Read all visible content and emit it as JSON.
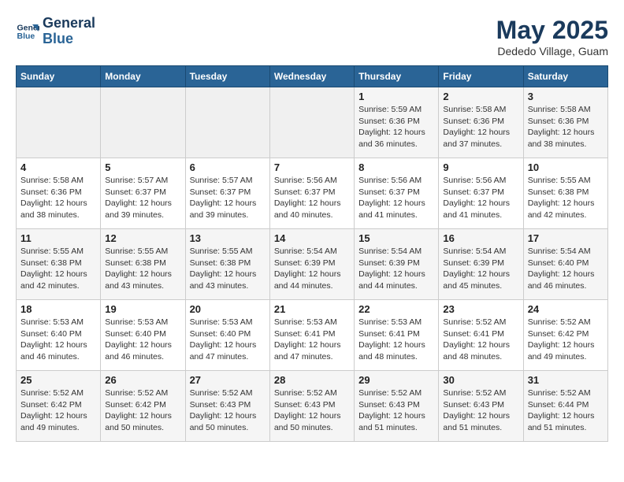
{
  "header": {
    "logo_line1": "General",
    "logo_line2": "Blue",
    "month": "May 2025",
    "location": "Dededo Village, Guam"
  },
  "weekdays": [
    "Sunday",
    "Monday",
    "Tuesday",
    "Wednesday",
    "Thursday",
    "Friday",
    "Saturday"
  ],
  "weeks": [
    [
      {
        "day": "",
        "text": ""
      },
      {
        "day": "",
        "text": ""
      },
      {
        "day": "",
        "text": ""
      },
      {
        "day": "",
        "text": ""
      },
      {
        "day": "1",
        "text": "Sunrise: 5:59 AM\nSunset: 6:36 PM\nDaylight: 12 hours\nand 36 minutes."
      },
      {
        "day": "2",
        "text": "Sunrise: 5:58 AM\nSunset: 6:36 PM\nDaylight: 12 hours\nand 37 minutes."
      },
      {
        "day": "3",
        "text": "Sunrise: 5:58 AM\nSunset: 6:36 PM\nDaylight: 12 hours\nand 38 minutes."
      }
    ],
    [
      {
        "day": "4",
        "text": "Sunrise: 5:58 AM\nSunset: 6:36 PM\nDaylight: 12 hours\nand 38 minutes."
      },
      {
        "day": "5",
        "text": "Sunrise: 5:57 AM\nSunset: 6:37 PM\nDaylight: 12 hours\nand 39 minutes."
      },
      {
        "day": "6",
        "text": "Sunrise: 5:57 AM\nSunset: 6:37 PM\nDaylight: 12 hours\nand 39 minutes."
      },
      {
        "day": "7",
        "text": "Sunrise: 5:56 AM\nSunset: 6:37 PM\nDaylight: 12 hours\nand 40 minutes."
      },
      {
        "day": "8",
        "text": "Sunrise: 5:56 AM\nSunset: 6:37 PM\nDaylight: 12 hours\nand 41 minutes."
      },
      {
        "day": "9",
        "text": "Sunrise: 5:56 AM\nSunset: 6:37 PM\nDaylight: 12 hours\nand 41 minutes."
      },
      {
        "day": "10",
        "text": "Sunrise: 5:55 AM\nSunset: 6:38 PM\nDaylight: 12 hours\nand 42 minutes."
      }
    ],
    [
      {
        "day": "11",
        "text": "Sunrise: 5:55 AM\nSunset: 6:38 PM\nDaylight: 12 hours\nand 42 minutes."
      },
      {
        "day": "12",
        "text": "Sunrise: 5:55 AM\nSunset: 6:38 PM\nDaylight: 12 hours\nand 43 minutes."
      },
      {
        "day": "13",
        "text": "Sunrise: 5:55 AM\nSunset: 6:38 PM\nDaylight: 12 hours\nand 43 minutes."
      },
      {
        "day": "14",
        "text": "Sunrise: 5:54 AM\nSunset: 6:39 PM\nDaylight: 12 hours\nand 44 minutes."
      },
      {
        "day": "15",
        "text": "Sunrise: 5:54 AM\nSunset: 6:39 PM\nDaylight: 12 hours\nand 44 minutes."
      },
      {
        "day": "16",
        "text": "Sunrise: 5:54 AM\nSunset: 6:39 PM\nDaylight: 12 hours\nand 45 minutes."
      },
      {
        "day": "17",
        "text": "Sunrise: 5:54 AM\nSunset: 6:40 PM\nDaylight: 12 hours\nand 46 minutes."
      }
    ],
    [
      {
        "day": "18",
        "text": "Sunrise: 5:53 AM\nSunset: 6:40 PM\nDaylight: 12 hours\nand 46 minutes."
      },
      {
        "day": "19",
        "text": "Sunrise: 5:53 AM\nSunset: 6:40 PM\nDaylight: 12 hours\nand 46 minutes."
      },
      {
        "day": "20",
        "text": "Sunrise: 5:53 AM\nSunset: 6:40 PM\nDaylight: 12 hours\nand 47 minutes."
      },
      {
        "day": "21",
        "text": "Sunrise: 5:53 AM\nSunset: 6:41 PM\nDaylight: 12 hours\nand 47 minutes."
      },
      {
        "day": "22",
        "text": "Sunrise: 5:53 AM\nSunset: 6:41 PM\nDaylight: 12 hours\nand 48 minutes."
      },
      {
        "day": "23",
        "text": "Sunrise: 5:52 AM\nSunset: 6:41 PM\nDaylight: 12 hours\nand 48 minutes."
      },
      {
        "day": "24",
        "text": "Sunrise: 5:52 AM\nSunset: 6:42 PM\nDaylight: 12 hours\nand 49 minutes."
      }
    ],
    [
      {
        "day": "25",
        "text": "Sunrise: 5:52 AM\nSunset: 6:42 PM\nDaylight: 12 hours\nand 49 minutes."
      },
      {
        "day": "26",
        "text": "Sunrise: 5:52 AM\nSunset: 6:42 PM\nDaylight: 12 hours\nand 50 minutes."
      },
      {
        "day": "27",
        "text": "Sunrise: 5:52 AM\nSunset: 6:43 PM\nDaylight: 12 hours\nand 50 minutes."
      },
      {
        "day": "28",
        "text": "Sunrise: 5:52 AM\nSunset: 6:43 PM\nDaylight: 12 hours\nand 50 minutes."
      },
      {
        "day": "29",
        "text": "Sunrise: 5:52 AM\nSunset: 6:43 PM\nDaylight: 12 hours\nand 51 minutes."
      },
      {
        "day": "30",
        "text": "Sunrise: 5:52 AM\nSunset: 6:43 PM\nDaylight: 12 hours\nand 51 minutes."
      },
      {
        "day": "31",
        "text": "Sunrise: 5:52 AM\nSunset: 6:44 PM\nDaylight: 12 hours\nand 51 minutes."
      }
    ]
  ]
}
